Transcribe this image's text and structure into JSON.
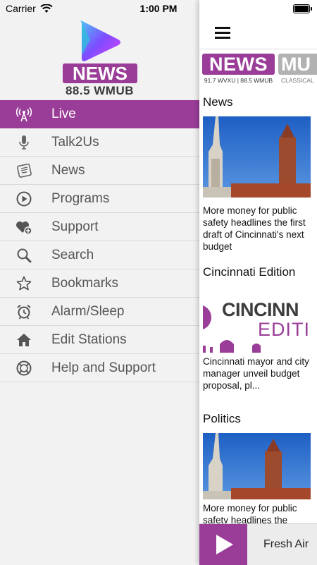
{
  "status_bar": {
    "carrier": "Carrier",
    "time": "1:00 PM"
  },
  "brand": {
    "logo_text": "NEWS",
    "call_sign": "88.5 WMUB",
    "accent": "#9a3d98"
  },
  "menu": {
    "items": [
      {
        "label": "Live",
        "icon": "antenna-icon",
        "active": true
      },
      {
        "label": "Talk2Us",
        "icon": "microphone-icon"
      },
      {
        "label": "News",
        "icon": "newspaper-icon"
      },
      {
        "label": "Programs",
        "icon": "play-circle-icon"
      },
      {
        "label": "Support",
        "icon": "heart-plus-icon"
      },
      {
        "label": "Search",
        "icon": "search-icon"
      },
      {
        "label": "Bookmarks",
        "icon": "star-icon"
      },
      {
        "label": "Alarm/Sleep",
        "icon": "alarm-clock-icon"
      },
      {
        "label": "Edit Stations",
        "icon": "home-icon"
      },
      {
        "label": "Help and Support",
        "icon": "help-icon"
      }
    ]
  },
  "stations": [
    {
      "name": "NEWS",
      "sub": "91.7 WVXU | 88.5 WMUB"
    },
    {
      "name": "MU",
      "sub": "CLASSICAL"
    }
  ],
  "sections": [
    {
      "title": "News",
      "headline": "More money for public safety headlines the first draft of Cincinnati's next budget"
    },
    {
      "title": "Cincinnati Edition",
      "headline": "Cincinnati mayor and city manager unveil budget proposal, pl...",
      "art_text_1": "CINCINN",
      "art_text_2": "EDITI"
    },
    {
      "title": "Politics",
      "headline": "More money for public safety headlines the"
    }
  ],
  "player": {
    "title": "Fresh Air"
  }
}
